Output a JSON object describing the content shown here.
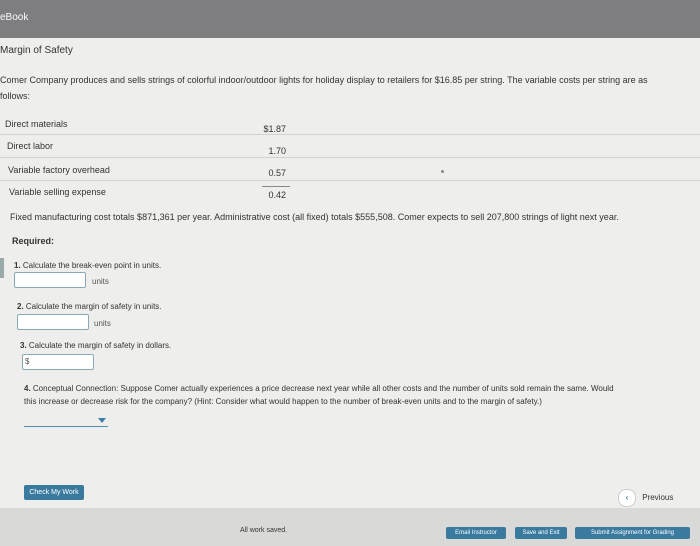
{
  "app": {
    "brand": "eBook"
  },
  "problem": {
    "title": "Margin of Safety",
    "intro_line1": "Comer Company produces and sells strings of colorful indoor/outdoor lights for holiday display to retailers for $16.85 per string. The variable costs per string are as",
    "intro_line2": "follows:",
    "costs": [
      {
        "label": "Direct materials",
        "value": "$1.87"
      },
      {
        "label": "Direct labor",
        "value": "1.70"
      },
      {
        "label": "Variable factory overhead",
        "value": "0.57"
      },
      {
        "label": "Variable selling expense",
        "value": "0.42"
      }
    ],
    "fixed_text": "Fixed manufacturing cost totals $871,361 per year. Administrative cost (all fixed) totals $555,508. Comer expects to sell 207,800 strings of light next year.",
    "required_label": "Required:"
  },
  "questions": {
    "q1": {
      "number": "1.",
      "text": "Calculate the break-even point in units.",
      "unit": "units",
      "value": ""
    },
    "q2": {
      "number": "2.",
      "text": "Calculate the margin of safety in units.",
      "unit": "units",
      "value": ""
    },
    "q3": {
      "number": "3.",
      "text": "Calculate the margin of safety in dollars.",
      "prefix": "$",
      "value": ""
    },
    "q4": {
      "number": "4.",
      "line1": "Conceptual Connection: Suppose Comer actually experiences a price decrease next year while all other costs and the number of units sold remain the same. Would",
      "line2": "this increase or decrease risk for the company? (Hint: Consider what would happen to the number of break-even units and to the margin of safety.)",
      "selected": ""
    }
  },
  "actions": {
    "check_label": "Check My Work",
    "previous_label": "Previous"
  },
  "footer": {
    "status": "All work saved.",
    "email_label": "Email Instructor",
    "save_exit_label": "Save and Exit",
    "submit_label": "Submit Assignment for Grading"
  },
  "colors": {
    "accent": "#3a7a9f",
    "topbar": "#7e7e80"
  },
  "icons": {
    "previous": "chevron-left-icon",
    "dropdown": "chevron-down-icon"
  }
}
